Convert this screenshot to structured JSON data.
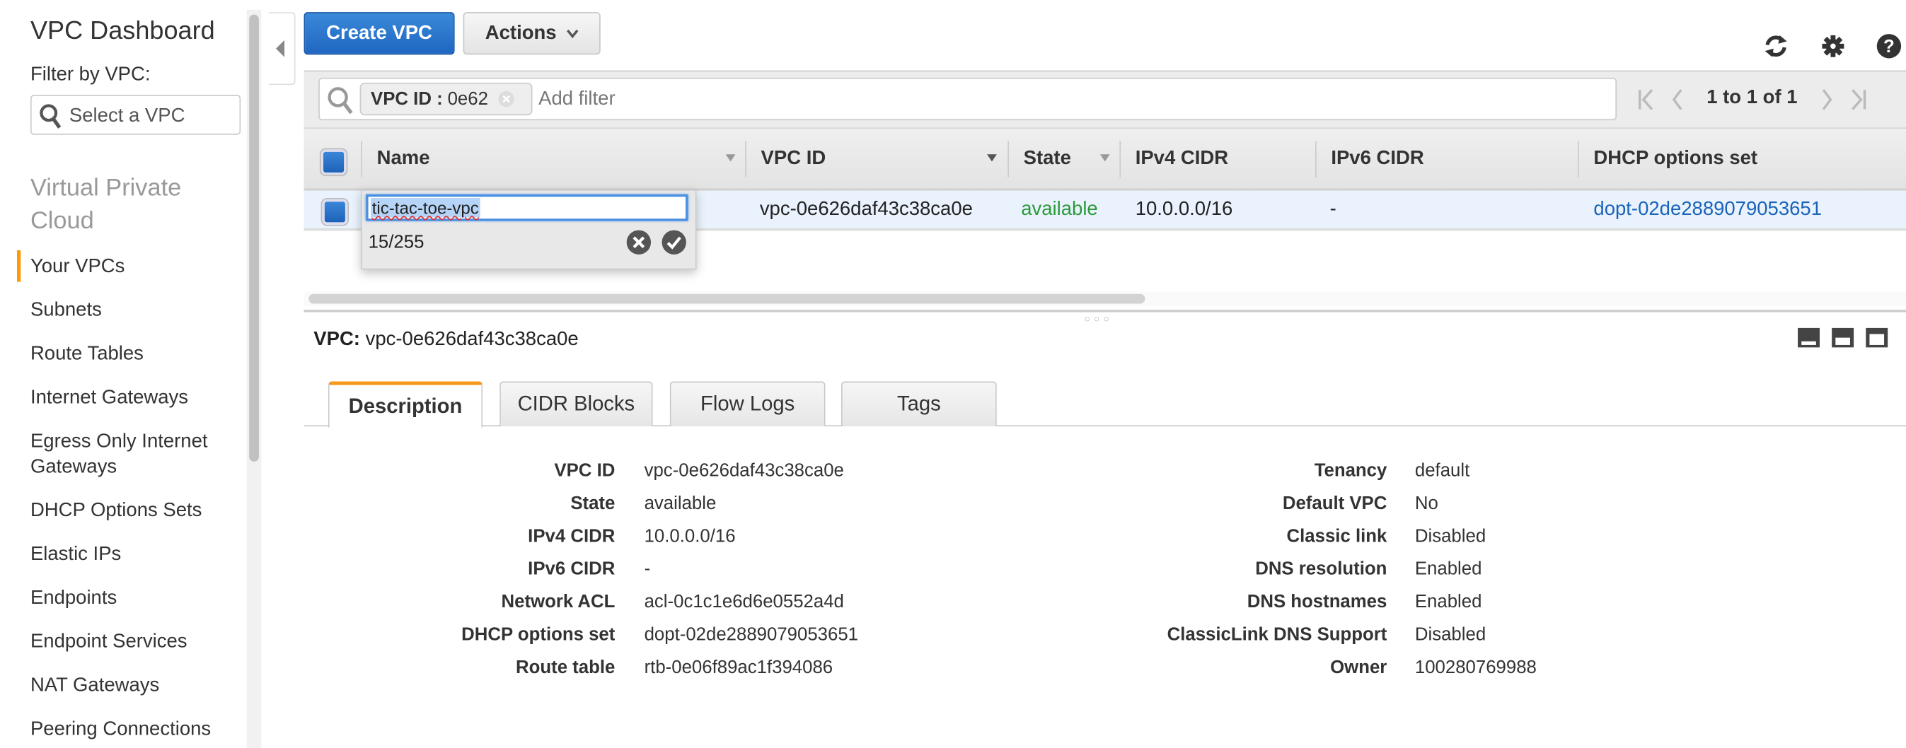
{
  "sidebar": {
    "title": "VPC Dashboard",
    "filter_label": "Filter by VPC:",
    "filter_placeholder": "Select a VPC",
    "group": "Virtual Private Cloud",
    "items": [
      {
        "label": "Your VPCs",
        "active": true
      },
      {
        "label": "Subnets"
      },
      {
        "label": "Route Tables"
      },
      {
        "label": "Internet Gateways"
      },
      {
        "label": "Egress Only Internet Gateways"
      },
      {
        "label": "DHCP Options Sets"
      },
      {
        "label": "Elastic IPs"
      },
      {
        "label": "Endpoints"
      },
      {
        "label": "Endpoint Services"
      },
      {
        "label": "NAT Gateways"
      },
      {
        "label": "Peering Connections"
      }
    ]
  },
  "toolbar": {
    "create_label": "Create VPC",
    "actions_label": "Actions",
    "icons": [
      "refresh-icon",
      "gear-icon",
      "help-icon"
    ],
    "primary_color": "#2a73cc"
  },
  "filter": {
    "chip_key": "VPC ID :",
    "chip_value": "0e62",
    "placeholder": "Add filter",
    "pager": "1 to 1 of 1"
  },
  "table": {
    "columns": [
      "Name",
      "VPC ID",
      "State",
      "IPv4 CIDR",
      "IPv6 CIDR",
      "DHCP options set"
    ],
    "rows": [
      {
        "name": "tic-tac-toe-vpc",
        "vpc_id": "vpc-0e626daf43c38ca0e",
        "state": "available",
        "ipv4": "10.0.0.0/16",
        "ipv6": "-",
        "dhcp": "dopt-02de2889079053651"
      }
    ],
    "editor": {
      "value": "tic-tac-toe-vpc",
      "counter": "15/255"
    }
  },
  "details": {
    "title_label": "VPC:",
    "title_value": "vpc-0e626daf43c38ca0e",
    "tabs": [
      "Description",
      "CIDR Blocks",
      "Flow Logs",
      "Tags"
    ],
    "active_tab": "Description",
    "left": [
      {
        "label": "VPC ID",
        "value": "vpc-0e626daf43c38ca0e"
      },
      {
        "label": "State",
        "value": "available"
      },
      {
        "label": "IPv4 CIDR",
        "value": "10.0.0.0/16"
      },
      {
        "label": "IPv6 CIDR",
        "value": "-"
      },
      {
        "label": "Network ACL",
        "value": "acl-0c1c1e6d6e0552a4d"
      },
      {
        "label": "DHCP options set",
        "value": "dopt-02de2889079053651"
      },
      {
        "label": "Route table",
        "value": "rtb-0e06f89ac1f394086"
      }
    ],
    "right": [
      {
        "label": "Tenancy",
        "value": "default"
      },
      {
        "label": "Default VPC",
        "value": "No"
      },
      {
        "label": "Classic link",
        "value": "Disabled"
      },
      {
        "label": "DNS resolution",
        "value": "Enabled"
      },
      {
        "label": "DNS hostnames",
        "value": "Enabled"
      },
      {
        "label": "ClassicLink DNS Support",
        "value": "Disabled"
      },
      {
        "label": "Owner",
        "value": "100280769988"
      }
    ]
  }
}
